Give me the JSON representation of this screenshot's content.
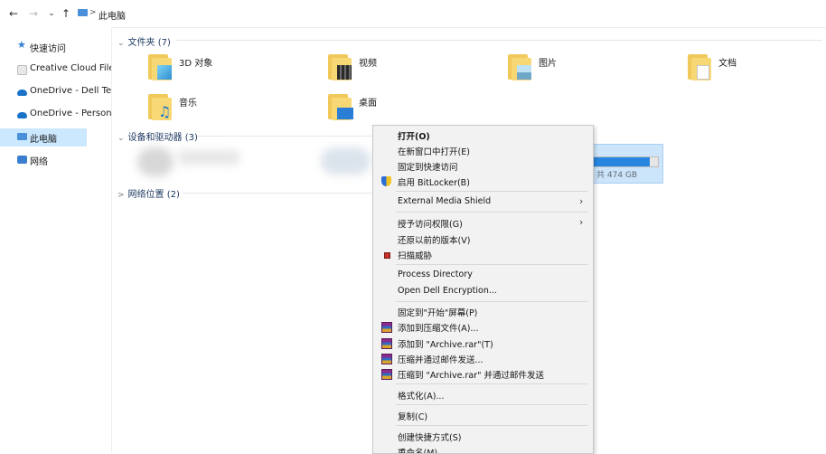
{
  "address_bar": {
    "back_icon": "arrow-left",
    "forward_icon": "arrow-right",
    "recent_icon": "chevron-down",
    "up_icon": "arrow-up",
    "breadcrumb": "此电脑"
  },
  "sidebar": {
    "items": [
      {
        "label": "快速访问",
        "icon": "star-icon"
      },
      {
        "label": "Creative Cloud Files",
        "icon": "creative-cloud-icon"
      },
      {
        "label": "OneDrive - Dell Technologies",
        "icon": "onedrive-icon"
      },
      {
        "label": "OneDrive - Personal",
        "icon": "onedrive-icon"
      },
      {
        "label": "此电脑",
        "icon": "computer-icon",
        "selected": true
      },
      {
        "label": "网络",
        "icon": "network-icon"
      }
    ]
  },
  "sections": {
    "folders_header": "文件夹 (7)",
    "devices_header": "设备和驱动器 (3)",
    "network_header": "网络位置 (2)"
  },
  "folders": [
    {
      "label": "3D 对象",
      "icon": "3d-objects-folder-icon"
    },
    {
      "label": "视频",
      "icon": "videos-folder-icon"
    },
    {
      "label": "图片",
      "icon": "pictures-folder-icon"
    },
    {
      "label": "文档",
      "icon": "documents-folder-icon"
    },
    {
      "label": "音乐",
      "icon": "music-folder-icon"
    },
    {
      "label": "桌面",
      "icon": "desktop-folder-icon"
    }
  ],
  "drive": {
    "size_text": "共 474 GB",
    "used_fraction": 0.92,
    "bar_color": "#2686e0"
  },
  "context_menu": {
    "items": [
      {
        "label": "打开(O)",
        "bold": true
      },
      {
        "label": "在新窗口中打开(E)"
      },
      {
        "label": "固定到快速访问"
      },
      {
        "label": "启用 BitLocker(B)",
        "icon": "bitlocker-shield-icon"
      },
      {
        "label": "External Media Shield",
        "submenu": true
      },
      {
        "label": "授予访问权限(G)",
        "submenu": true
      },
      {
        "label": "还原以前的版本(V)"
      },
      {
        "label": "扫描威胁",
        "icon": "scan-threats-icon"
      },
      {
        "label": "Process Directory"
      },
      {
        "label": "Open Dell Encryption..."
      },
      {
        "label": "固定到\"开始\"屏幕(P)"
      },
      {
        "label": "添加到压缩文件(A)...",
        "icon": "winrar-icon"
      },
      {
        "label": "添加到 \"Archive.rar\"(T)",
        "icon": "winrar-icon"
      },
      {
        "label": "压缩并通过邮件发送...",
        "icon": "winrar-icon"
      },
      {
        "label": "压缩到 \"Archive.rar\" 并通过邮件发送",
        "icon": "winrar-icon"
      },
      {
        "label": "格式化(A)..."
      },
      {
        "label": "复制(C)"
      },
      {
        "label": "创建快捷方式(S)"
      },
      {
        "label": "重命名(M)"
      }
    ]
  },
  "colors": {
    "selection": "#cce8ff",
    "accent": "#2686e0",
    "folder": "#f8d775"
  }
}
